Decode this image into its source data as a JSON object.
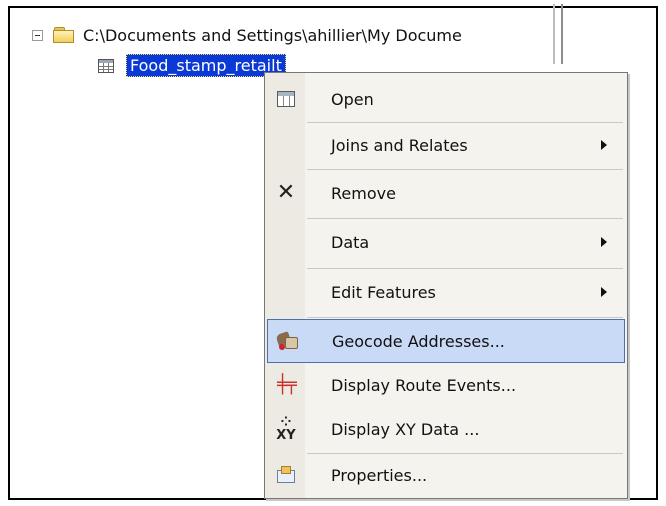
{
  "tree": {
    "folder_path": "C:\\Documents and Settings\\ahillier\\My Docume",
    "selected_item": "Food_stamp_retailt"
  },
  "context_menu": {
    "items": [
      {
        "label": "Open",
        "icon": "table-icon",
        "submenu": false
      },
      {
        "label": "Joins and Relates",
        "icon": "",
        "submenu": true
      },
      {
        "label": "Remove",
        "icon": "remove-x-icon",
        "submenu": false
      },
      {
        "label": "Data",
        "icon": "",
        "submenu": true
      },
      {
        "label": "Edit Features",
        "icon": "",
        "submenu": true
      },
      {
        "label": "Geocode Addresses...",
        "icon": "geocode-icon",
        "submenu": false,
        "highlighted": true
      },
      {
        "label": "Display Route Events...",
        "icon": "route-events-icon",
        "submenu": false
      },
      {
        "label": "Display XY Data ...",
        "icon": "xy-data-icon",
        "submenu": false
      },
      {
        "label": "Properties...",
        "icon": "properties-icon",
        "submenu": false
      }
    ]
  },
  "colors": {
    "selection": "#0a39d6",
    "menu_highlight": "#c9daf7",
    "route_icon": "#c9332b"
  }
}
